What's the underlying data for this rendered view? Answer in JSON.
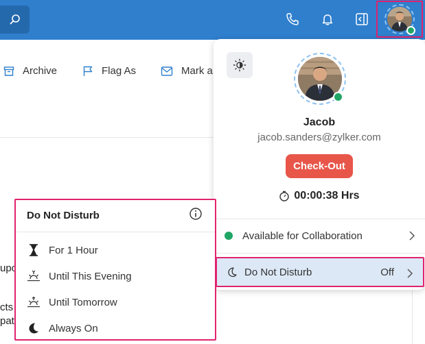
{
  "topbar": {
    "icons": [
      "search-icon",
      "phone-icon",
      "bell-icon",
      "panel-collapse-icon",
      "avatar"
    ],
    "accent": "#2f7fcd"
  },
  "toolbar": {
    "archive_label": "Archive",
    "flag_label": "Flag As",
    "mark_label": "Mark a"
  },
  "background_fragments": {
    "frag1": "upo",
    "frag2": "cts",
    "frag3": "pat",
    "frag4": "i    ...  i i i  i"
  },
  "profile": {
    "name": "Jacob",
    "email": "jacob.sanders@zylker.com",
    "checkout_label": "Check-Out",
    "timer": "00:00:38 Hrs",
    "status_label": "Available for Collaboration",
    "dnd_label": "Do Not Disturb",
    "dnd_value": "Off",
    "status_color": "#1fa666",
    "checkout_color": "#e8564a"
  },
  "dnd_menu": {
    "title": "Do Not Disturb",
    "items": [
      {
        "label": "For 1 Hour",
        "icon": "hourglass-icon"
      },
      {
        "label": "Until This Evening",
        "icon": "sunset-icon"
      },
      {
        "label": "Until Tomorrow",
        "icon": "sunrise-icon"
      },
      {
        "label": "Always On",
        "icon": "moon-icon"
      }
    ]
  }
}
